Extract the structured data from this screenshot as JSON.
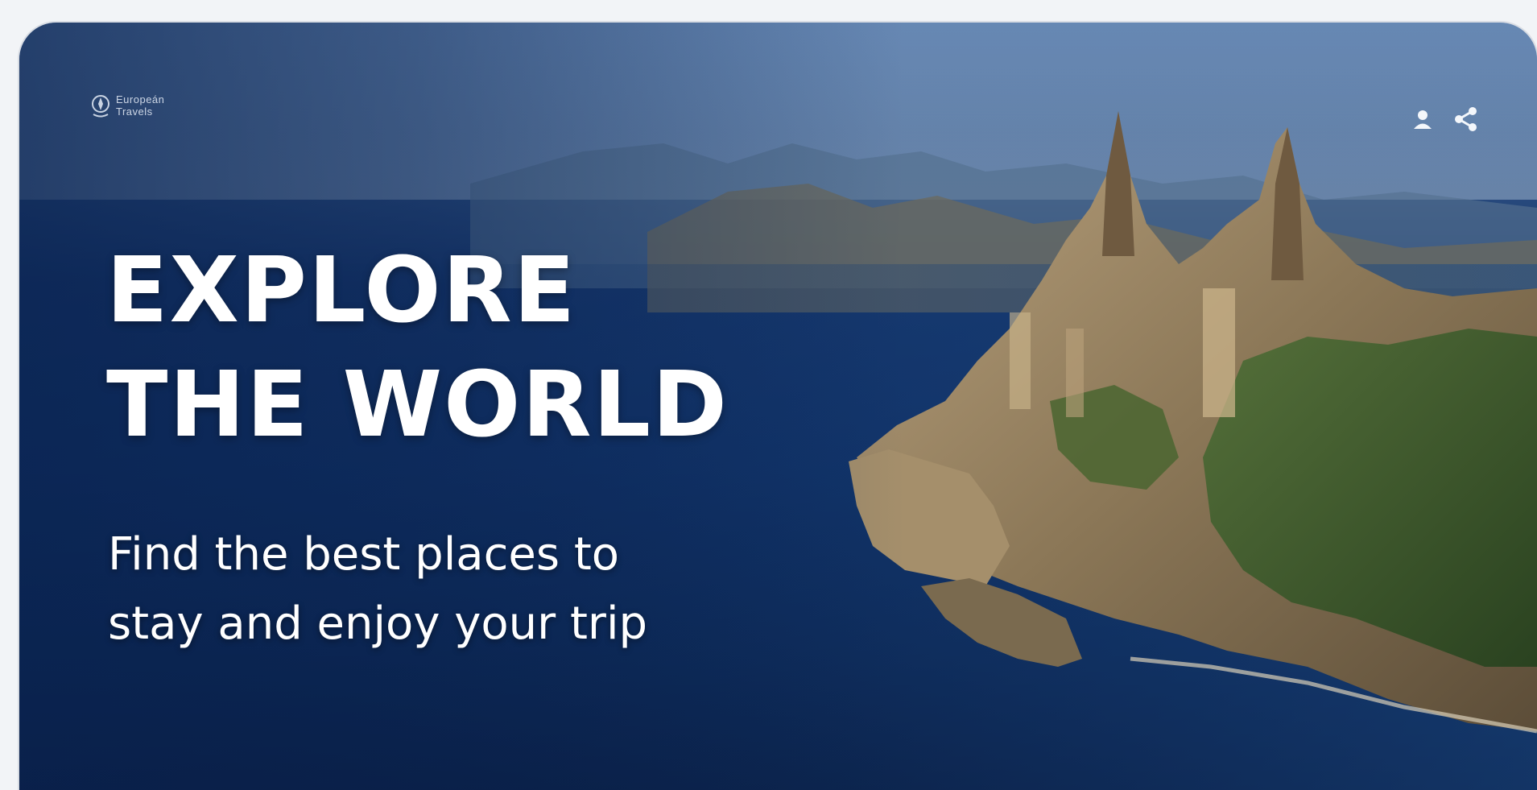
{
  "brand": {
    "line1": "Europeán",
    "line2": "Travels",
    "logo_icon": "compass-logo-icon"
  },
  "actions": {
    "user_icon": "user-icon",
    "share_icon": "share-icon"
  },
  "hero": {
    "title_line1": "EXPLORE",
    "title_line2": "THE WORLD",
    "subtitle_line1": "Find the best places to",
    "subtitle_line2": "stay and enjoy your trip"
  },
  "colors": {
    "sea": "#0f2f63",
    "sky": "#5c7fae",
    "rock": "#8f7d62",
    "forest": "#3b5a2a",
    "text": "#ffffff"
  }
}
